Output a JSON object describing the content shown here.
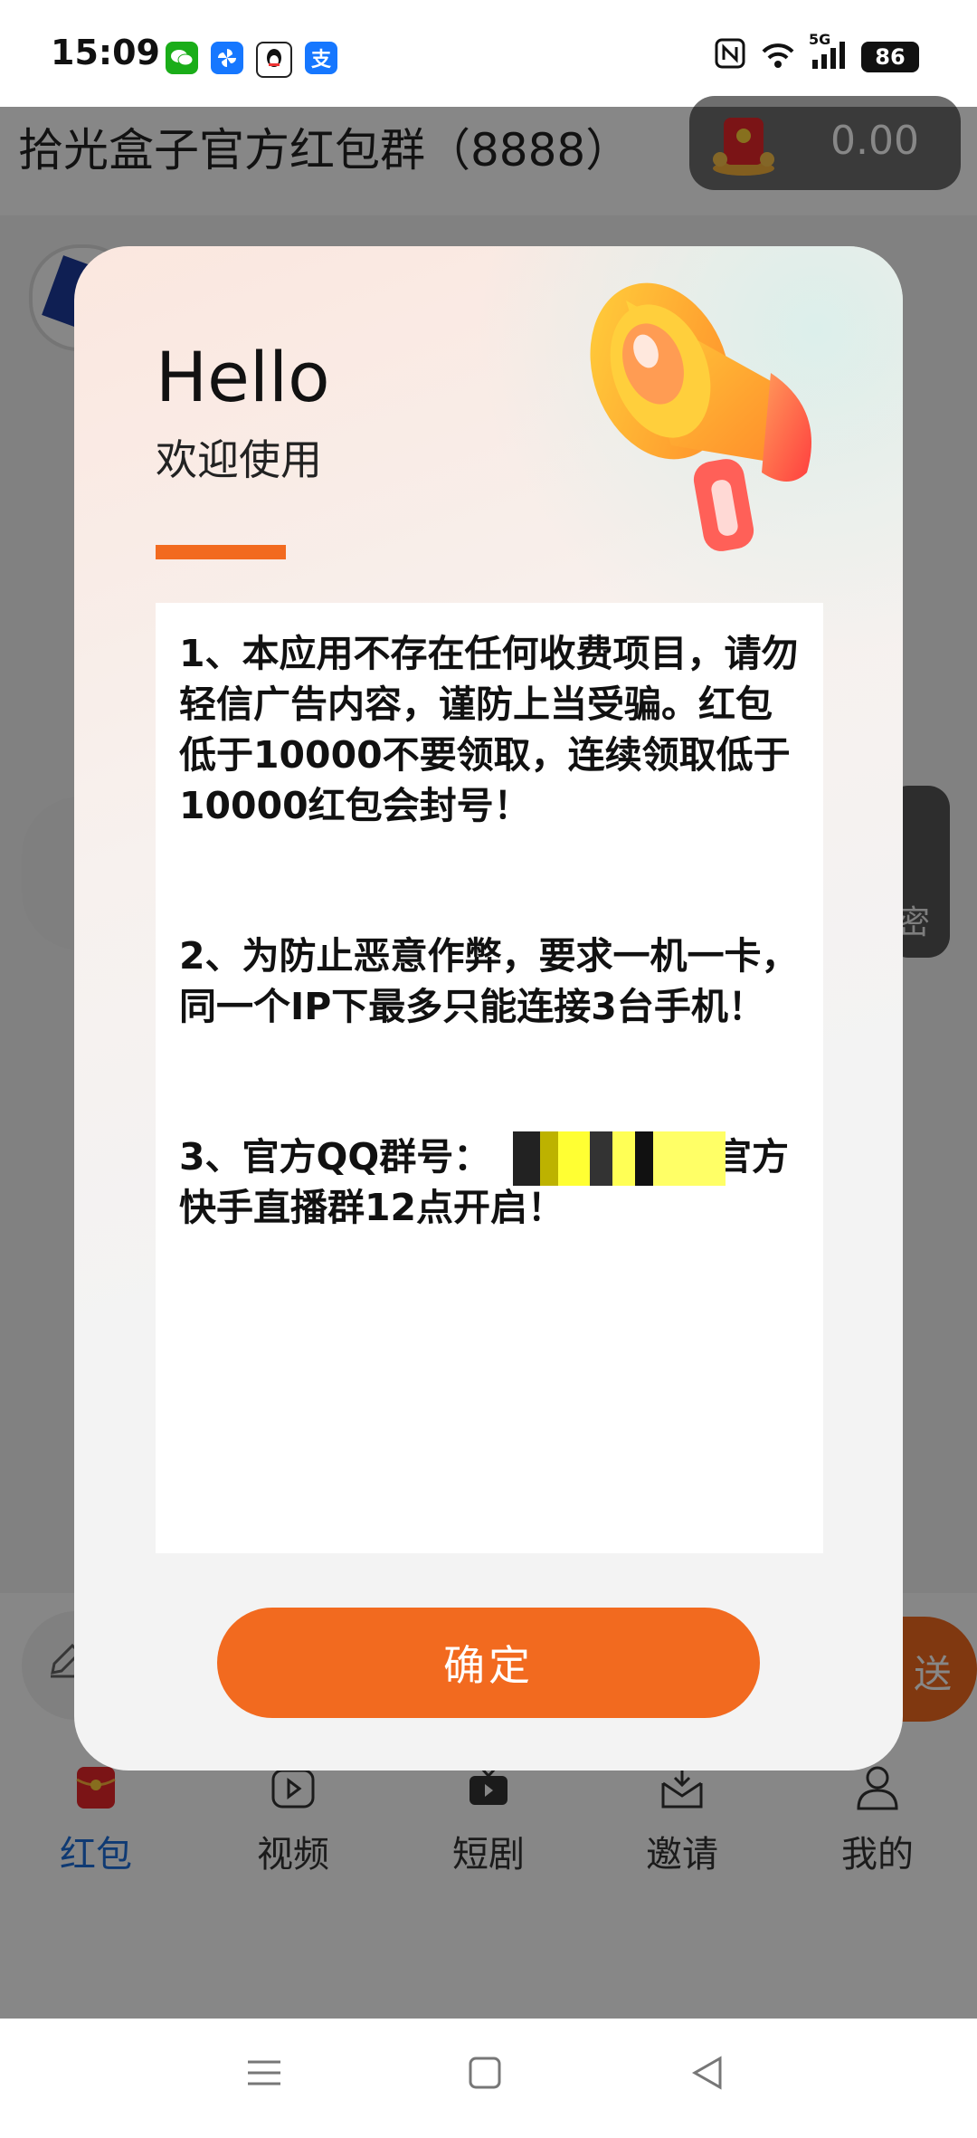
{
  "status_bar": {
    "time": "15:09",
    "notification_icons": [
      "wechat-icon",
      "pinwheel-app-icon",
      "qq-icon",
      "alipay-icon"
    ],
    "alipay_glyph": "支",
    "network_label": "5G",
    "battery": "86"
  },
  "header": {
    "group_title": "拾光盒子官方红包群（8888）",
    "balance": "0.00"
  },
  "side_tab_label": "密",
  "send_button_label": "送",
  "bottom_nav": [
    {
      "label": "红包",
      "icon": "red-packet-icon"
    },
    {
      "label": "视频",
      "icon": "video-icon"
    },
    {
      "label": "短剧",
      "icon": "drama-icon"
    },
    {
      "label": "邀请",
      "icon": "invite-icon"
    },
    {
      "label": "我的",
      "icon": "profile-icon"
    }
  ],
  "modal": {
    "heading": "Hello",
    "subheading": "欢迎使用",
    "notices": [
      "1、本应用不存在任何收费项目，请勿轻信广告内容，谨防上当受骗。红包低于10000不要领取，连续领取低于10000红包会封号！",
      "2、为防止恶意作弊，要求一机一卡，同一个IP下最多只能连接3台手机！",
      "3、官方QQ群号：          每天下午3点官方快手直播群12点开启！"
    ],
    "confirm_label": "确定"
  },
  "colors": {
    "accent": "#f26a1f",
    "active_nav": "#1e6fd9"
  }
}
